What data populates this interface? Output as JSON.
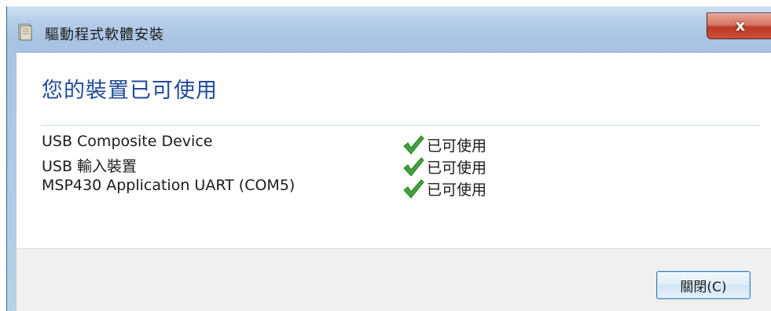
{
  "window": {
    "title": "驅動程式軟體安裝",
    "close_glyph": "x"
  },
  "main": {
    "heading": "您的裝置已可使用",
    "devices": [
      {
        "name": "USB Composite Device",
        "status": "已可使用"
      },
      {
        "name": "USB 輸入裝置",
        "status": "已可使用"
      },
      {
        "name": "MSP430 Application UART (COM5)",
        "status": "已可使用"
      }
    ]
  },
  "footer": {
    "close_button_label": "關閉(C)"
  },
  "colors": {
    "heading": "#1f4b98",
    "check": "#3fa33a",
    "close_button_red": "#c9503a"
  }
}
